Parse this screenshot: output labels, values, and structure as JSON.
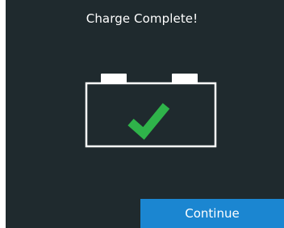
{
  "dialog": {
    "title": "Charge Complete!",
    "icon": "battery-check-icon",
    "continue_label": "Continue"
  },
  "colors": {
    "background": "#1f2a2e",
    "accent": "#1b86d1",
    "check": "#2fb34a"
  }
}
